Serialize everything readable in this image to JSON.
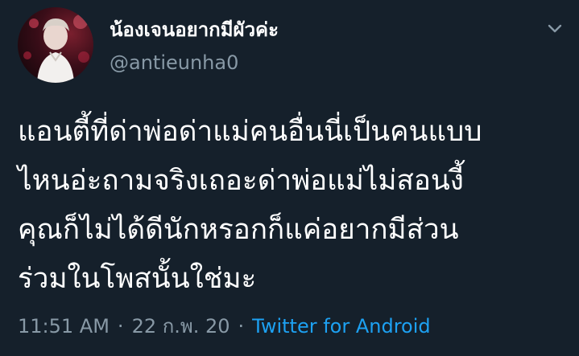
{
  "tweet": {
    "display_name": "น้องเจนอยากมีผัวค่ะ",
    "handle": "@antieunha0",
    "body_lines": [
      "แอนตี้ที่ด่าพ่อด่าแม่คนอื่นนี่เป็นคนแบบ",
      "ไหนอ่ะถามจริงเถอะด่าพ่อแม่ไม่สอนงี้",
      "คุณก็ไม่ได้ดีนักหรอกก็แค่อยากมีส่วน",
      "ร่วมในโพสนั้นใช่มะ"
    ],
    "time": "11:51 AM",
    "date": "22 ก.พ. 20",
    "separator": "·",
    "source": "Twitter for Android"
  },
  "icons": {
    "avatar": "avatar-photo",
    "caret": "chevron-down-icon"
  },
  "colors": {
    "background": "#15202b",
    "primary_text": "#ffffff",
    "secondary_text": "#8899a6",
    "link": "#1da1f2"
  }
}
